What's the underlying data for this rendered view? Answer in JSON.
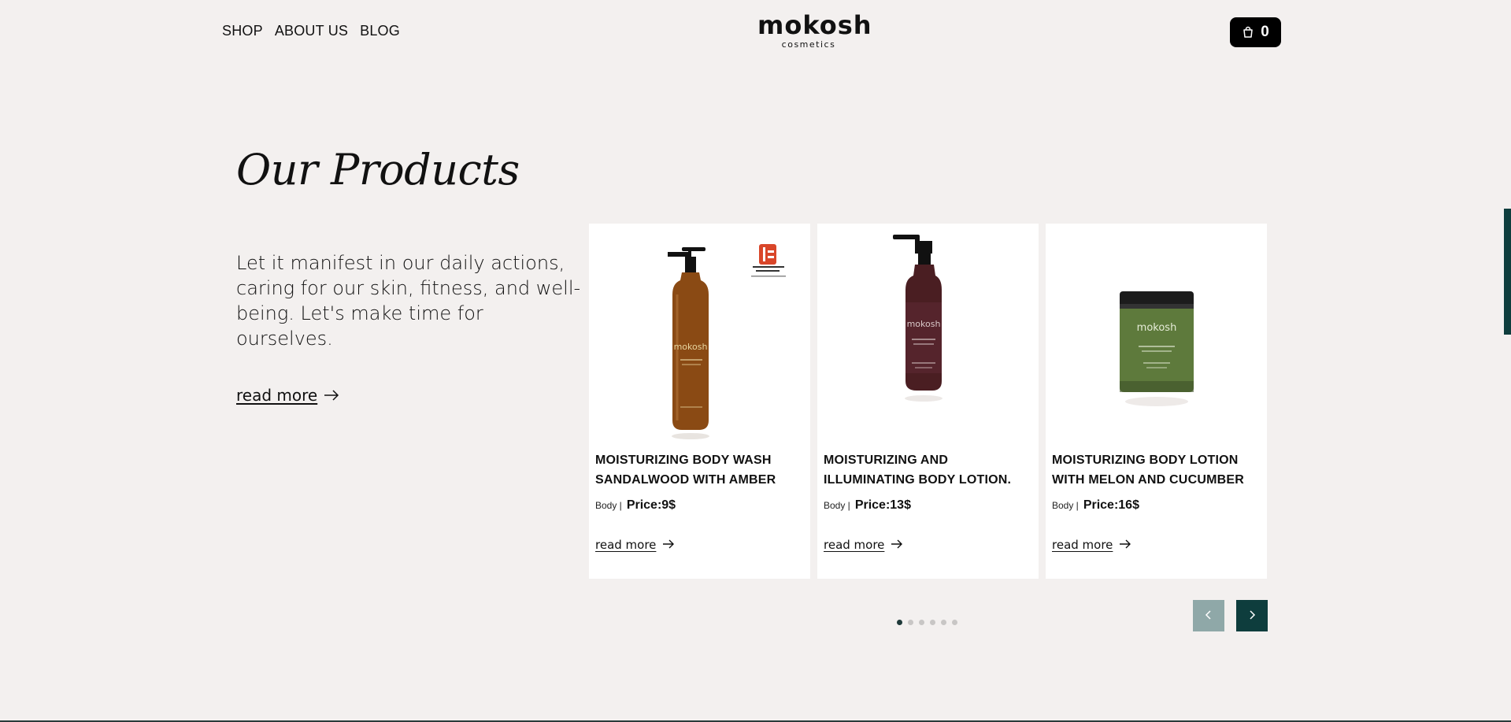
{
  "header": {
    "nav": [
      {
        "label": "SHOP"
      },
      {
        "label": "ABOUT US"
      },
      {
        "label": "BLOG"
      }
    ],
    "logo": {
      "main": "mokosh",
      "sub": "cosmetics"
    },
    "cart": {
      "icon": "shopping-bag-icon",
      "count": "0"
    }
  },
  "main": {
    "title": "Our Products",
    "intro": "Let it manifest in our daily actions, caring for our skin, fitness, and well-being. Let's make time for ourselves.",
    "read_more": "read more"
  },
  "products": [
    {
      "title": "MOISTURIZING BODY WASH SANDALWOOD WITH AMBER",
      "category": "Body |",
      "price": "Price:9$",
      "read_more": "read more",
      "bottle_color": "#8a4a14",
      "image_logo": "mokosh"
    },
    {
      "title": "MOISTURIZING AND ILLUMINATING BODY LOTION.",
      "category": "Body |",
      "price": "Price:13$",
      "read_more": "read more",
      "bottle_color": "#4a1e22",
      "image_logo": "mokosh"
    },
    {
      "title": "MOISTURIZING BODY LOTION WITH MELON AND CUCUMBER",
      "category": "Body |",
      "price": "Price:16$",
      "read_more": "read more",
      "bottle_color": "#5e7a3c",
      "image_logo": "mokosh"
    }
  ],
  "carousel": {
    "dot_count": 6,
    "active_index": 0,
    "prev_icon": "chevron-left-icon",
    "next_icon": "chevron-right-icon"
  },
  "colors": {
    "background": "#f3f0ef",
    "accent": "#0e3d3d",
    "accent_muted": "#8fa8a8"
  }
}
